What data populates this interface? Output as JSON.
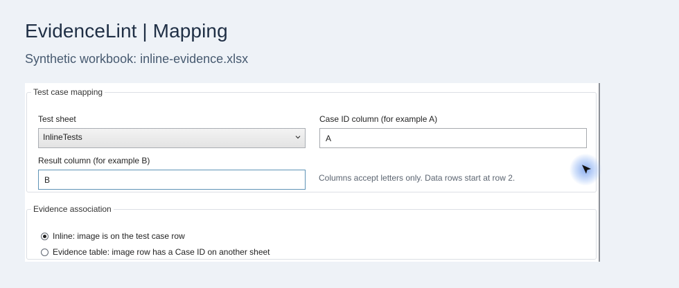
{
  "header": {
    "title": "EvidenceLint | Mapping",
    "subtitle": "Synthetic workbook: inline-evidence.xlsx"
  },
  "mapping": {
    "legend": "Test case mapping",
    "test_sheet": {
      "label": "Test sheet",
      "value": "InlineTests"
    },
    "case_id_column": {
      "label": "Case ID column (for example A)",
      "value": "A"
    },
    "result_column": {
      "label": "Result column (for example B)",
      "value": "B"
    },
    "hint": "Columns accept letters only. Data rows start at row 2."
  },
  "evidence": {
    "legend": "Evidence association",
    "options": [
      {
        "label": "Inline: image is on the test case row",
        "selected": true
      },
      {
        "label": "Evidence table: image row has a Case ID on another sheet",
        "selected": false
      }
    ]
  },
  "icons": {
    "select_chevron": "chevron-down-icon",
    "cursor": "mouse-pointer-icon"
  },
  "colors": {
    "page_background": "#eef2f7",
    "focus_border": "#5e93b6",
    "cursor_highlight": "#7ea0eb"
  }
}
